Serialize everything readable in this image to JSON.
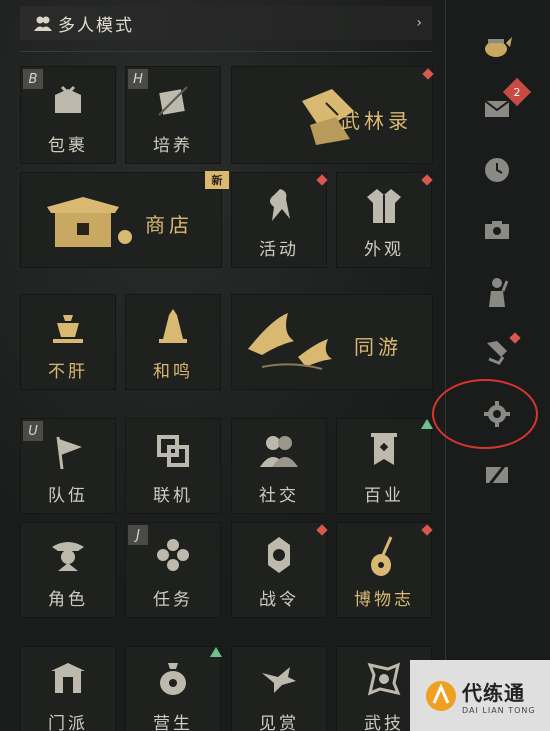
{
  "mode_bar": {
    "label": "多人模式",
    "chevron": "›"
  },
  "tiles": {
    "baoguo": {
      "name": "包裹",
      "key": "B"
    },
    "peiyang": {
      "name": "培养",
      "key": "H"
    },
    "wulinlu": {
      "name": "武林录"
    },
    "shangdian": {
      "name": "商店",
      "badge": "新"
    },
    "huodong": {
      "name": "活动"
    },
    "waiguan": {
      "name": "外观"
    },
    "bugan": {
      "name": "不肝"
    },
    "heming": {
      "name": "和鸣"
    },
    "tongyou": {
      "name": "同游"
    },
    "duiwu": {
      "name": "队伍",
      "key": "U"
    },
    "lianji": {
      "name": "联机"
    },
    "shejiao": {
      "name": "社交"
    },
    "baiye": {
      "name": "百业"
    },
    "juese": {
      "name": "角色"
    },
    "renwu": {
      "name": "任务",
      "key": "J"
    },
    "zhanling": {
      "name": "战令"
    },
    "bowuzhi": {
      "name": "博物志"
    },
    "menpai": {
      "name": "门派"
    },
    "yingsheng": {
      "name": "营生"
    },
    "jianshang": {
      "name": "见赏"
    },
    "wuji": {
      "name": "武技"
    }
  },
  "sidebar": {
    "mail_count": "2"
  },
  "watermark": {
    "cn": "代练通",
    "en": "DAI LIAN TONG"
  },
  "colors": {
    "gold": "#d9b872",
    "red_dot": "#d8584f",
    "green_tri": "#6fbf8c",
    "ring": "#d8342f"
  }
}
